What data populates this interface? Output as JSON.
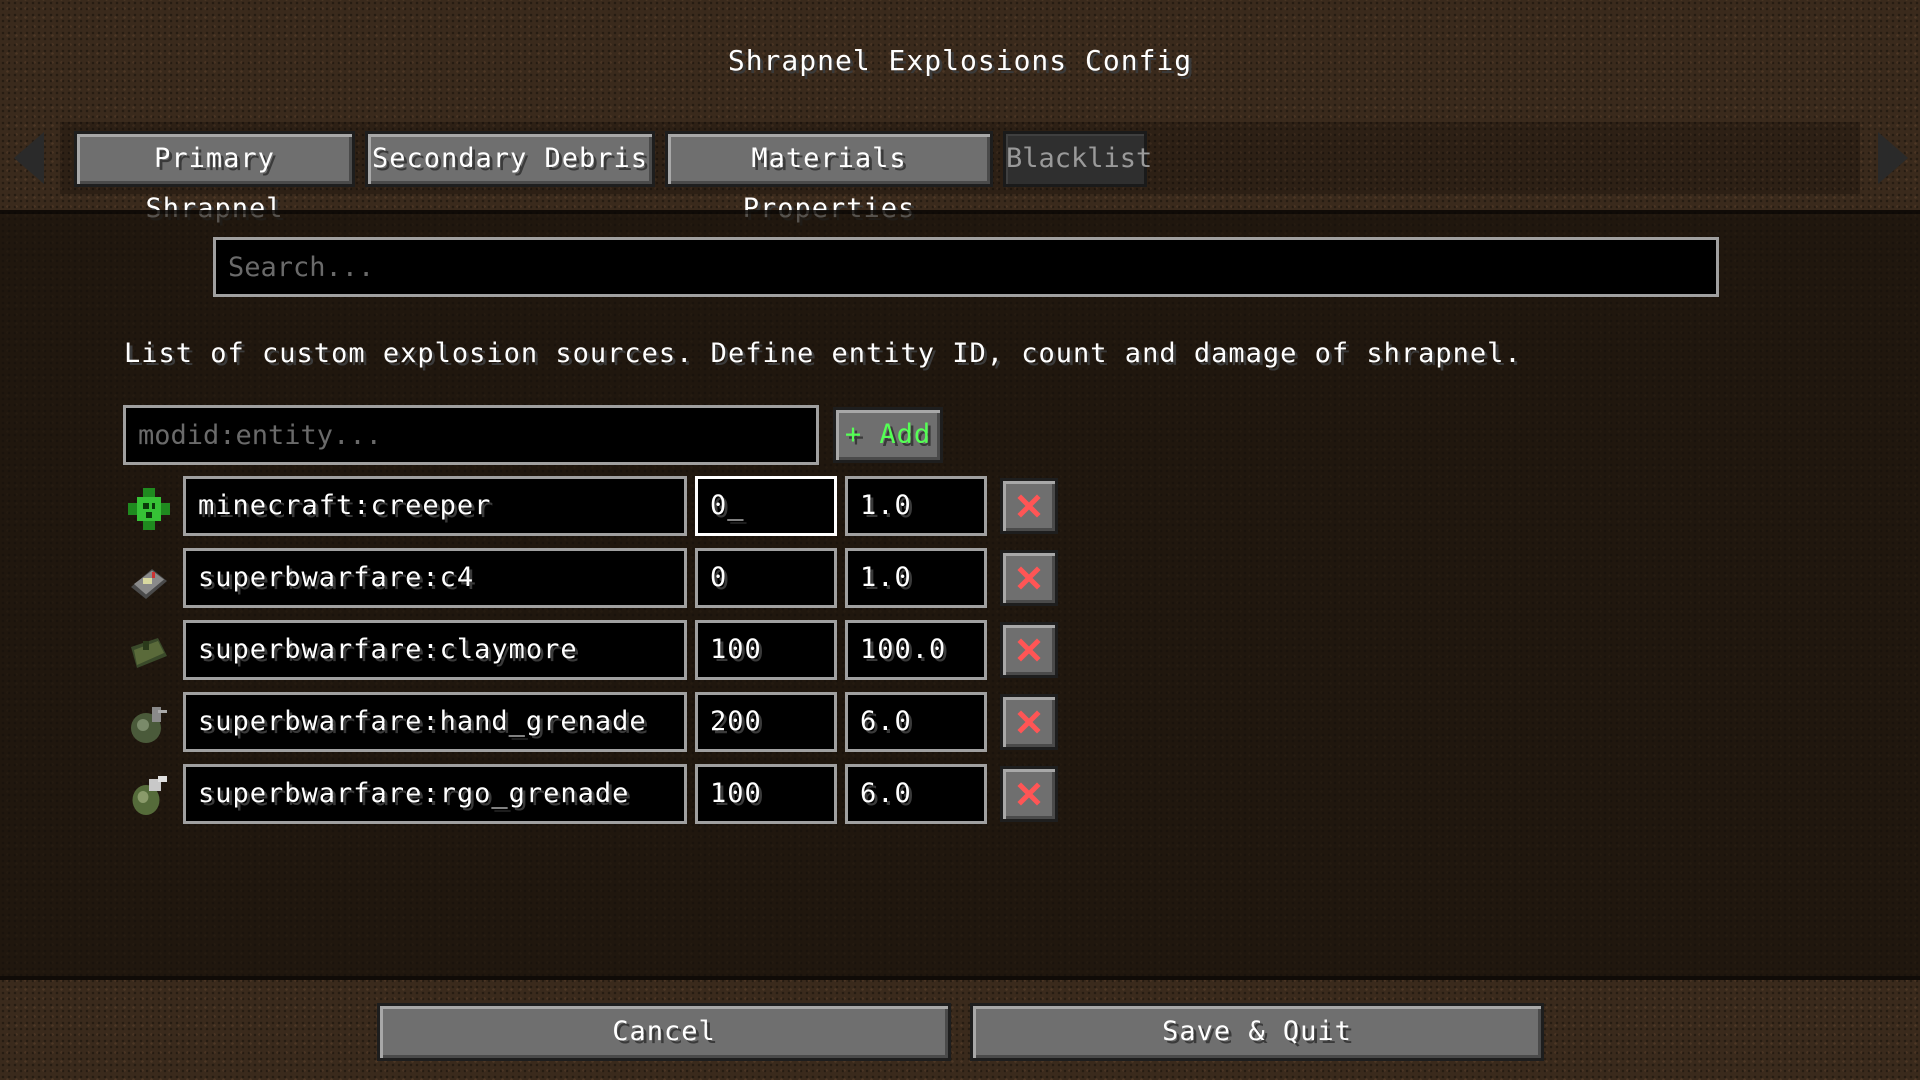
{
  "title": "Shrapnel Explosions Config",
  "tabs": [
    {
      "label": "Primary Shrapnel",
      "active": false
    },
    {
      "label": "Secondary Debris",
      "active": false
    },
    {
      "label": "Materials Properties",
      "active": false
    },
    {
      "label": "Blacklist",
      "active": true
    }
  ],
  "search": {
    "placeholder": "Search...",
    "value": ""
  },
  "description": "List of custom explosion sources. Define entity ID, count and damage of shrapnel.",
  "entity_input": {
    "placeholder": "modid:entity...",
    "value": ""
  },
  "add_button": {
    "label": "+ Add"
  },
  "entries": [
    {
      "icon": "creeper-icon",
      "id": "minecraft:creeper",
      "count": "0_",
      "damage": "1.0"
    },
    {
      "icon": "c4-icon",
      "id": "superbwarfare:c4",
      "count": "0",
      "damage": "1.0"
    },
    {
      "icon": "claymore-icon",
      "id": "superbwarfare:claymore",
      "count": "100",
      "damage": "100.0"
    },
    {
      "icon": "hand-grenade-icon",
      "id": "superbwarfare:hand_grenade",
      "count": "200",
      "damage": "6.0"
    },
    {
      "icon": "rgo-grenade-icon",
      "id": "superbwarfare:rgo_grenade",
      "count": "100",
      "damage": "6.0"
    }
  ],
  "footer": {
    "cancel_label": "Cancel",
    "save_label": "Save & Quit"
  },
  "colors": {
    "add_text": "#55ff55",
    "delete_icon": "#ff5555",
    "active_tab_text": "#9a9a9a"
  }
}
